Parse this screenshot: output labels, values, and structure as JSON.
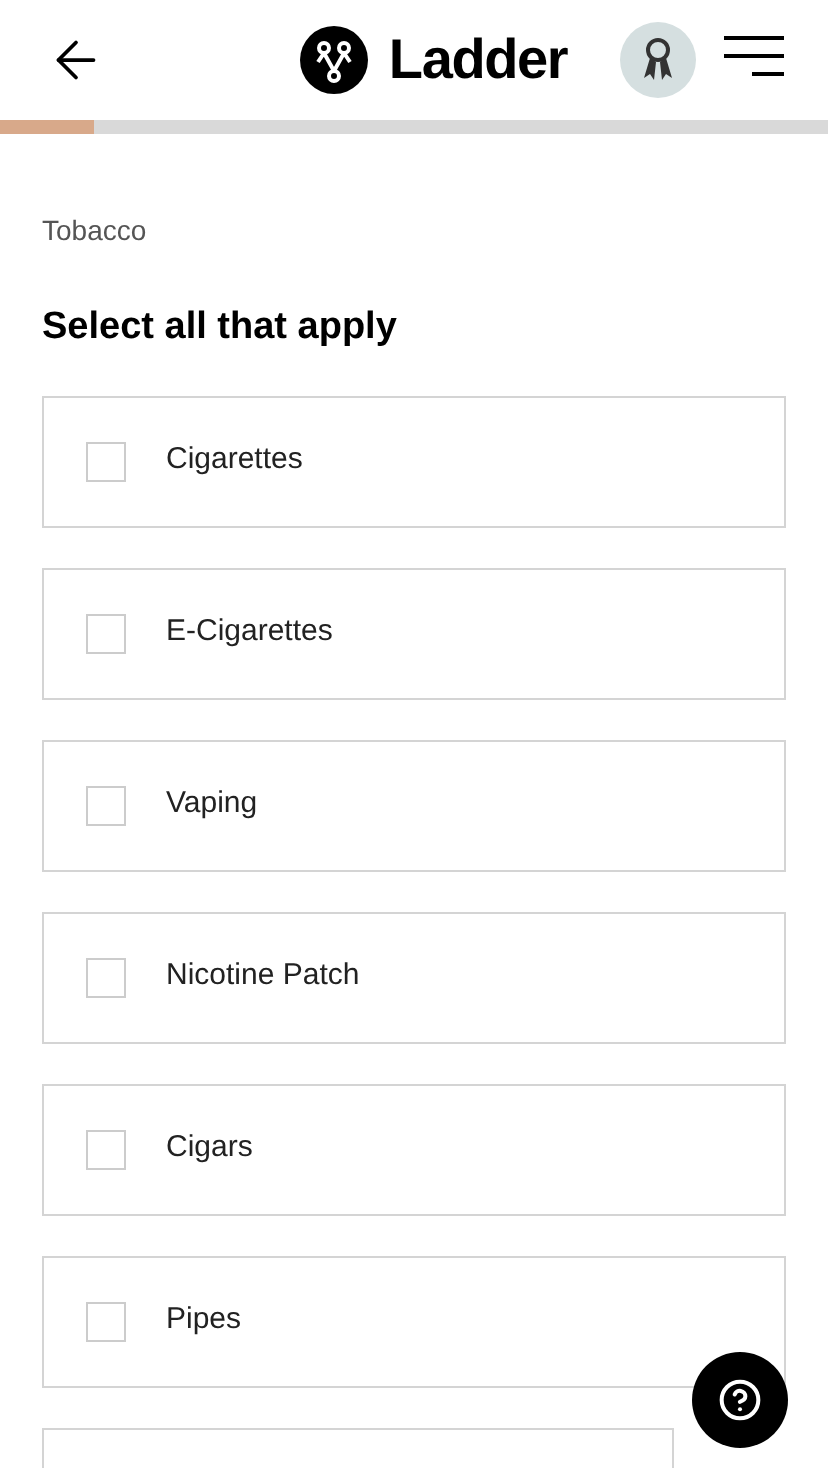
{
  "header": {
    "logo_text": "Ladder"
  },
  "progress": {
    "level": 0.113
  },
  "section": "Tobacco",
  "question": "Select all that apply",
  "options": [
    {
      "label": "Cigarettes",
      "checked": false
    },
    {
      "label": "E-Cigarettes",
      "checked": false
    },
    {
      "label": "Vaping",
      "checked": false
    },
    {
      "label": "Nicotine Patch",
      "checked": false
    },
    {
      "label": "Cigars",
      "checked": false
    },
    {
      "label": "Pipes",
      "checked": false
    }
  ]
}
